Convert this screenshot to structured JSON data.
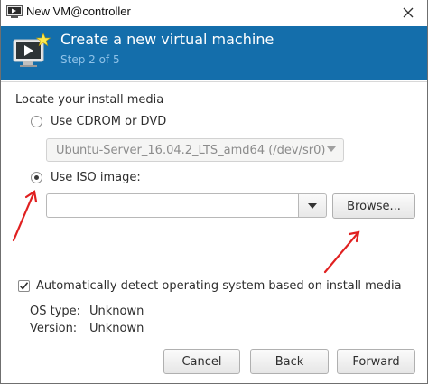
{
  "window": {
    "title": "New VM@controller",
    "close_glyph": "✕"
  },
  "header": {
    "title": "Create a new virtual machine",
    "step": "Step 2 of 5",
    "background_color": "#146eab",
    "icon": "monitor-new-icon"
  },
  "install_media": {
    "section_label": "Locate your install media",
    "cdrom_option": {
      "label": "Use CDROM or DVD",
      "selected": false,
      "device_value": "Ubuntu-Server_16.04.2_LTS_amd64 (/dev/sr0)"
    },
    "iso_option": {
      "label": "Use ISO image:",
      "selected": true,
      "path_value": "",
      "browse_label": "Browse..."
    }
  },
  "os_detection": {
    "auto_detect_label": "Automatically detect operating system based on install media",
    "auto_detect_checked": true,
    "os_type_key": "OS type:",
    "os_type_value": "Unknown",
    "version_key": "Version:",
    "version_value": "Unknown"
  },
  "footer": {
    "cancel_label": "Cancel",
    "back_label": "Back",
    "forward_label": "Forward"
  },
  "annotations": {
    "arrow_color": "#e02020"
  }
}
